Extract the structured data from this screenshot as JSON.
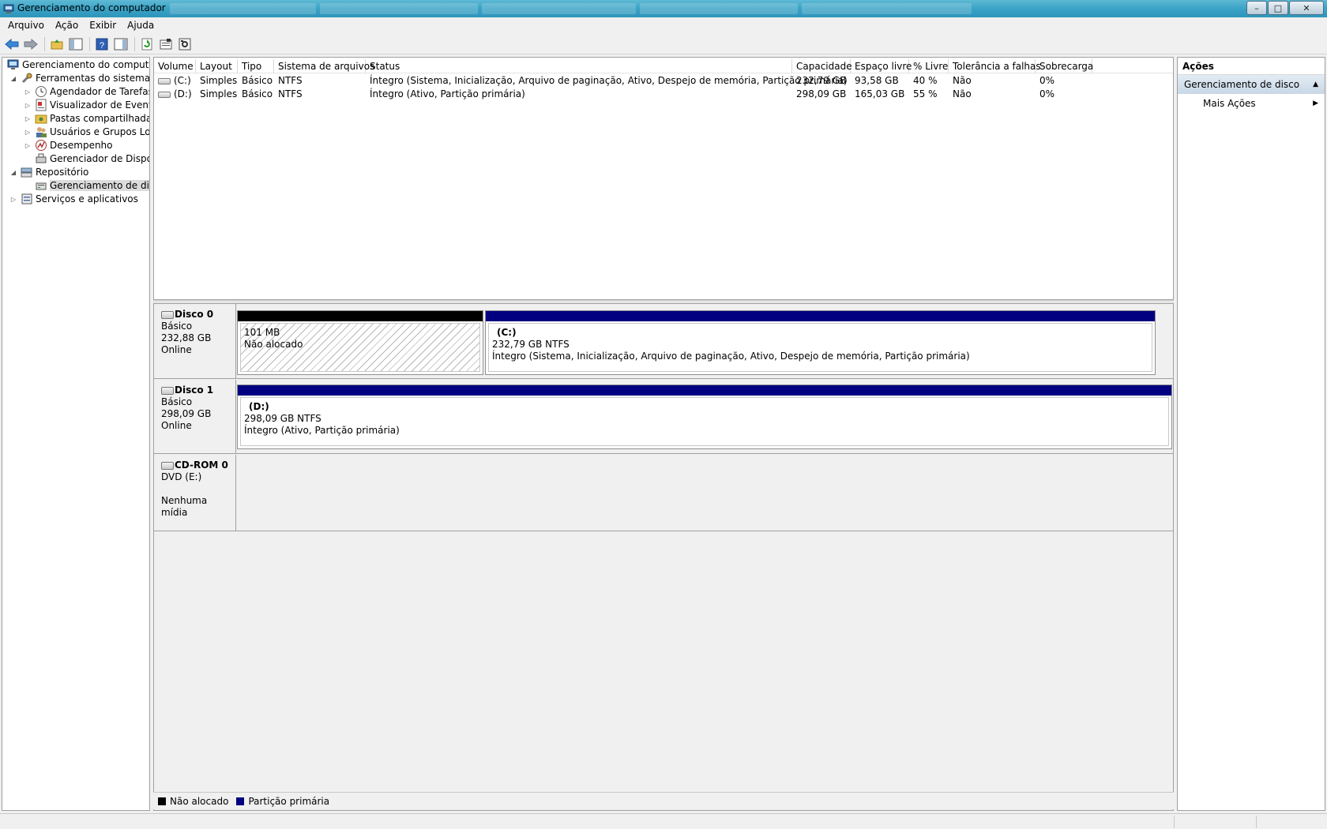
{
  "window": {
    "title": "Gerenciamento do computador",
    "controls": {
      "minimize": "–",
      "maximize": "□",
      "close": "✕"
    }
  },
  "menu": [
    "Arquivo",
    "Ação",
    "Exibir",
    "Ajuda"
  ],
  "toolbar": [
    "back-icon",
    "forward-icon",
    "up-folder-icon",
    "show-hide-tree-icon",
    "help-icon",
    "show-hide-action-icon",
    "refresh-icon",
    "properties-icon",
    "settings-icon"
  ],
  "tree": [
    {
      "label": "Gerenciamento do computado",
      "expander": "",
      "icon": "computer-mgmt-icon",
      "level": 0
    },
    {
      "label": "Ferramentas do sistema",
      "expander": "◢",
      "icon": "tools-icon",
      "level": 1
    },
    {
      "label": "Agendador de Tarefas",
      "expander": "▷",
      "icon": "clock-icon",
      "level": 2
    },
    {
      "label": "Visualizador de Eventos",
      "expander": "▷",
      "icon": "event-viewer-icon",
      "level": 2
    },
    {
      "label": "Pastas compartilhadas",
      "expander": "▷",
      "icon": "shared-folder-icon",
      "level": 2
    },
    {
      "label": "Usuários e Grupos Loca",
      "expander": "▷",
      "icon": "users-icon",
      "level": 2
    },
    {
      "label": "Desempenho",
      "expander": "▷",
      "icon": "performance-icon",
      "level": 2
    },
    {
      "label": "Gerenciador de Disposit",
      "expander": "",
      "icon": "device-manager-icon",
      "level": 2
    },
    {
      "label": "Repositório",
      "expander": "◢",
      "icon": "storage-icon",
      "level": 1
    },
    {
      "label": "Gerenciamento de disco",
      "expander": "",
      "icon": "disk-mgmt-icon",
      "level": 2,
      "selected": true
    },
    {
      "label": "Serviços e aplicativos",
      "expander": "▷",
      "icon": "services-icon",
      "level": 0
    }
  ],
  "volume_table": {
    "columns": [
      "Volume",
      "Layout",
      "Tipo",
      "Sistema de arquivos",
      "Status",
      "Capacidade",
      "Espaço livre",
      "% Livre",
      "Tolerância a falhas",
      "Sobrecarga"
    ],
    "rows": [
      [
        "(C:)",
        "Simples",
        "Básico",
        "NTFS",
        "Íntegro (Sistema, Inicialização, Arquivo de paginação, Ativo, Despejo de memória, Partição primária)",
        "232,79 GB",
        "93,58 GB",
        "40 %",
        "Não",
        "0%"
      ],
      [
        "(D:)",
        "Simples",
        "Básico",
        "NTFS",
        "Íntegro (Ativo, Partição primária)",
        "298,09 GB",
        "165,03 GB",
        "55 %",
        "Não",
        "0%"
      ]
    ]
  },
  "disks": [
    {
      "name": "Disco 0",
      "type": "Básico",
      "size": "232,88 GB",
      "state": "Online",
      "partitions": [
        {
          "volume": "",
          "size": "101 MB",
          "status": "Não alocado",
          "kind": "unallocated"
        },
        {
          "volume": "(C:)",
          "size": "232,79 GB NTFS",
          "status": "Íntegro (Sistema, Inicialização, Arquivo de paginação, Ativo, Despejo de memória, Partição primária)",
          "kind": "primary"
        }
      ]
    },
    {
      "name": "Disco 1",
      "type": "Básico",
      "size": "298,09 GB",
      "state": "Online",
      "partitions": [
        {
          "volume": "(D:)",
          "size": "298,09 GB NTFS",
          "status": "Íntegro (Ativo, Partição primária)",
          "kind": "primary"
        }
      ]
    },
    {
      "name": "CD-ROM 0",
      "type": "DVD (E:)",
      "size": "",
      "state": "Nenhuma mídia",
      "partitions": []
    }
  ],
  "legend": [
    {
      "label": "Não alocado",
      "color": "#000000"
    },
    {
      "label": "Partição primária",
      "color": "#000080"
    }
  ],
  "actions": {
    "header": "Ações",
    "section": "Gerenciamento de disco",
    "section_caret": "▲",
    "items": [
      {
        "label": "Mais Ações",
        "caret": "▶"
      }
    ]
  },
  "colors": {
    "unallocated_bar": "#000000",
    "primary_bar": "#000080",
    "titlebar": "#39a3c6"
  }
}
